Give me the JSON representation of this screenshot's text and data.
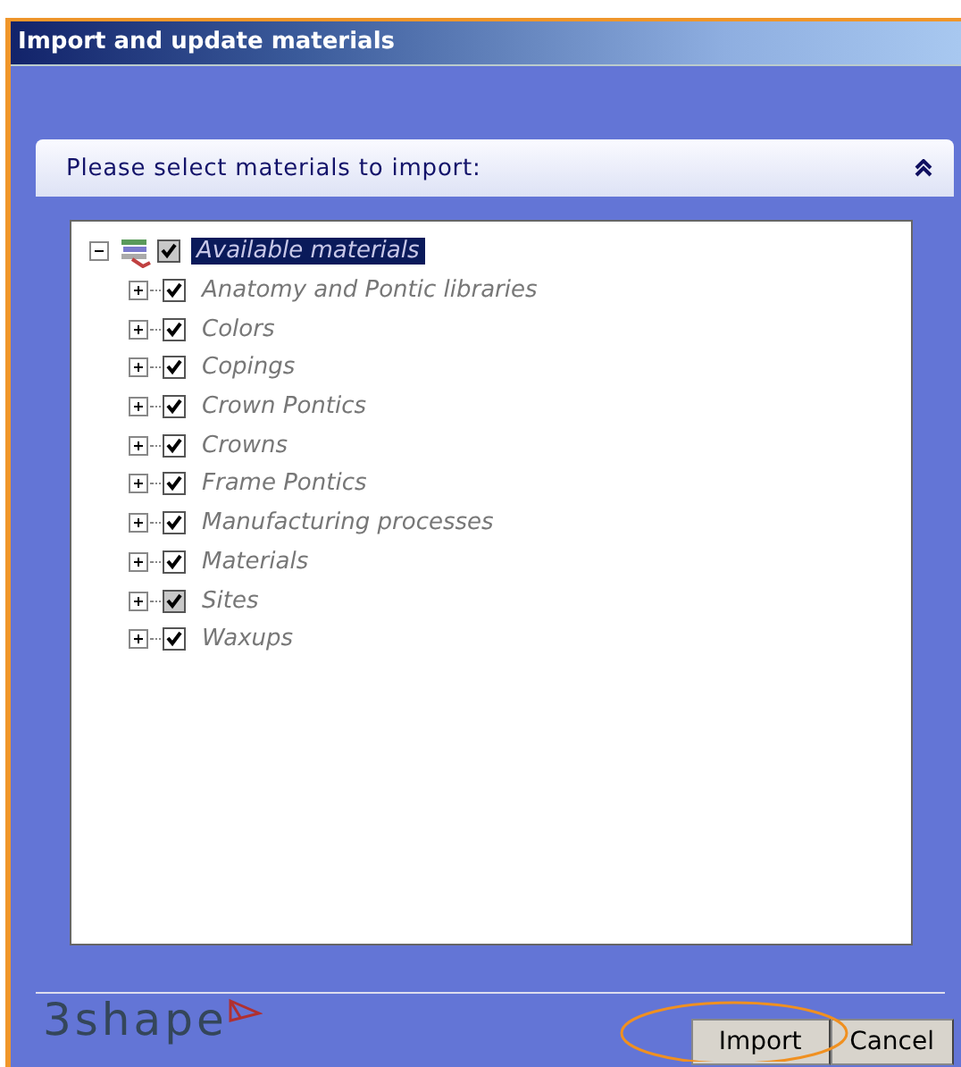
{
  "window": {
    "title": "Import and update materials"
  },
  "panel": {
    "title": "Please select materials to import:",
    "expanded": true
  },
  "tree": {
    "label": "Available materials",
    "checked": true,
    "partial": true,
    "selected": true,
    "expanded": true,
    "children": [
      {
        "label": "Anatomy and Pontic libraries",
        "checked": true,
        "expanded": false
      },
      {
        "label": "Colors",
        "checked": true,
        "expanded": false
      },
      {
        "label": "Copings",
        "checked": true,
        "expanded": false
      },
      {
        "label": "Crown Pontics",
        "checked": true,
        "expanded": false
      },
      {
        "label": "Crowns",
        "checked": true,
        "expanded": false
      },
      {
        "label": "Frame Pontics",
        "checked": true,
        "expanded": false
      },
      {
        "label": "Manufacturing processes",
        "checked": true,
        "expanded": false
      },
      {
        "label": "Materials",
        "checked": true,
        "expanded": false
      },
      {
        "label": "Sites",
        "checked": true,
        "partial": true,
        "expanded": false
      },
      {
        "label": "Waxups",
        "checked": true,
        "expanded": false
      }
    ]
  },
  "logo": {
    "text": "3shape"
  },
  "buttons": [
    "Import",
    "Cancel"
  ]
}
